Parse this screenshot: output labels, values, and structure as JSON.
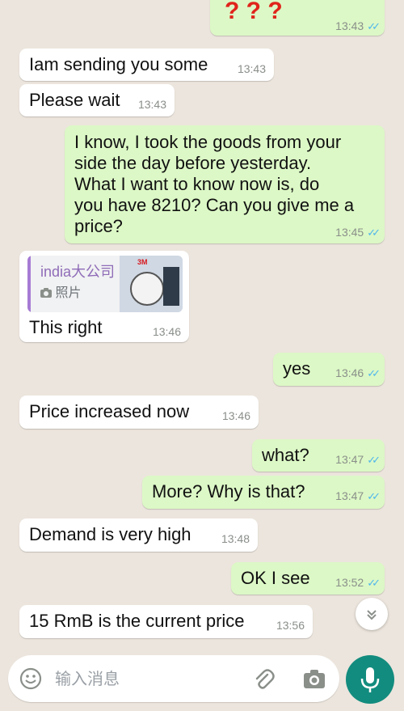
{
  "messages": [
    {
      "dir": "out",
      "text": "? ? ?",
      "time": "13:43",
      "ticks": "✓✓"
    },
    {
      "dir": "in",
      "text": "Iam sending you some",
      "time": "13:43"
    },
    {
      "dir": "in",
      "text": "Please wait",
      "time": "13:43"
    },
    {
      "dir": "out",
      "text": "I know, I took the goods from your\nside the day before yesterday.\nWhat I want to know now is, do\nyou have 8210? Can you give me a\nprice?",
      "time": "13:45",
      "ticks": "✓✓"
    },
    {
      "dir": "in",
      "quote": {
        "name": "india大公司",
        "type": "照片",
        "thumb_label": "3M"
      },
      "text": "This right",
      "time": "13:46"
    },
    {
      "dir": "out",
      "text": "yes",
      "time": "13:46",
      "ticks": "✓✓"
    },
    {
      "dir": "in",
      "text": "Price increased now",
      "time": "13:46"
    },
    {
      "dir": "out",
      "text": "what?",
      "time": "13:47",
      "ticks": "✓✓"
    },
    {
      "dir": "out",
      "text": "More? Why is that?",
      "time": "13:47",
      "ticks": "✓✓"
    },
    {
      "dir": "in",
      "text": "Demand is very high",
      "time": "13:48"
    },
    {
      "dir": "out",
      "text": "OK I see",
      "time": "13:52",
      "ticks": "✓✓"
    },
    {
      "dir": "in",
      "text": "15 RmB is the current price",
      "time": "13:56"
    }
  ],
  "input": {
    "placeholder": "输入消息"
  },
  "icons": {
    "emoji": "emoji-icon",
    "attach": "paperclip-icon",
    "camera": "camera-icon",
    "mic": "microphone-icon",
    "scroll_down": "double-chevron-down-icon",
    "read_receipt": "double-check-icon"
  },
  "colors": {
    "background": "#ece5dd",
    "outgoing_bubble": "#dcf8c6",
    "incoming_bubble": "#ffffff",
    "read_ticks": "#4fb6ec",
    "accent": "#128c7e",
    "question_marks": "#e0241b"
  }
}
